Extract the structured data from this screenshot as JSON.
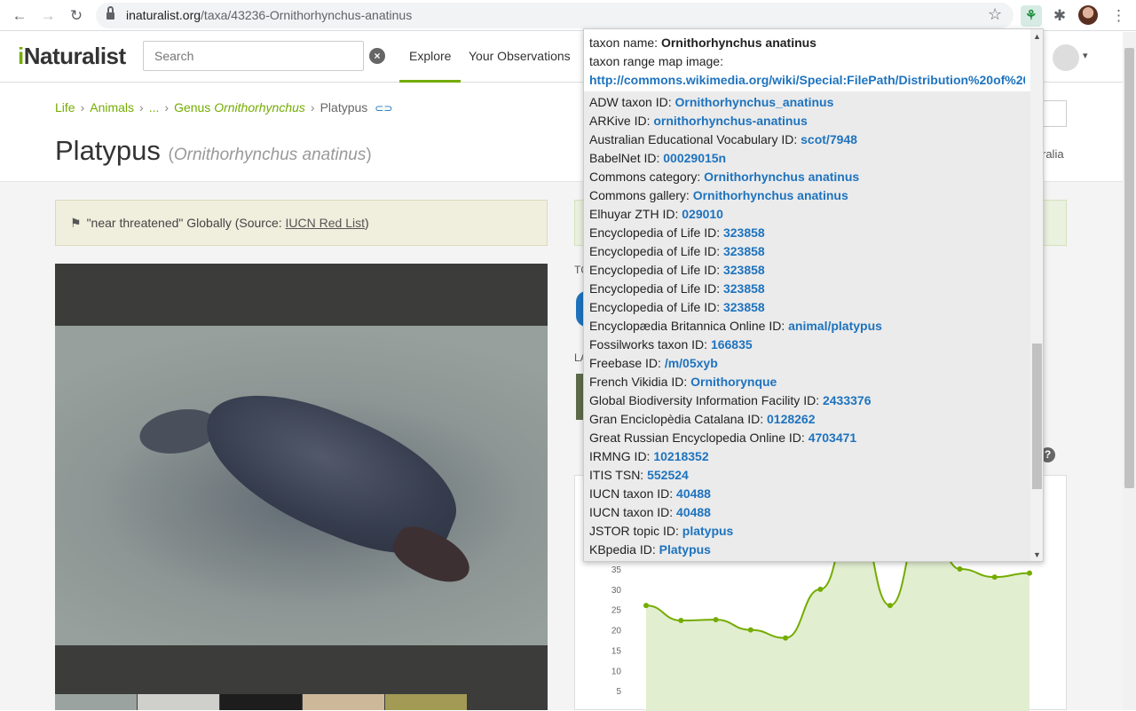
{
  "browser": {
    "url_domain": "inaturalist.org",
    "url_path": "/taxa/43236-Ornithorhynchus-anatinus"
  },
  "header": {
    "logo_i": "i",
    "logo_rest": "Naturalist",
    "search_placeholder": "Search",
    "nav": [
      "Explore",
      "Your Observations"
    ]
  },
  "breadcrumb": {
    "life": "Life",
    "animals": "Animals",
    "ellipsis": "...",
    "genus_prefix": "Genus ",
    "genus_name": "Ornithorhynchus",
    "current": "Platypus"
  },
  "taxon": {
    "common_name": "Platypus",
    "scientific_name": "Ornithorhynchus anatinus",
    "right_text": "ralia"
  },
  "status": {
    "status_text": "\"near threatened\" Globally (Source: ",
    "source_link": "IUCN Red List",
    "close_paren": ")"
  },
  "right_column": {
    "label_top": "TC",
    "label_mid": "LA"
  },
  "popup": {
    "taxon_name_label": "taxon name:",
    "taxon_name_value": "Ornithorhynchus anatinus",
    "range_map_label": "taxon range map image:",
    "range_map_url": "http://commons.wikimedia.org/wiki/Special:FilePath/Distribution%20of%20",
    "rows": [
      {
        "label": "ADW taxon ID:",
        "value": "Ornithorhynchus_anatinus"
      },
      {
        "label": "ARKive ID:",
        "value": "ornithorhynchus-anatinus"
      },
      {
        "label": "Australian Educational Vocabulary ID:",
        "value": "scot/7948"
      },
      {
        "label": "BabelNet ID:",
        "value": "00029015n"
      },
      {
        "label": "Commons category:",
        "value": "Ornithorhynchus anatinus"
      },
      {
        "label": "Commons gallery:",
        "value": "Ornithorhynchus anatinus"
      },
      {
        "label": "Elhuyar ZTH ID:",
        "value": "029010"
      },
      {
        "label": "Encyclopedia of Life ID:",
        "value": "323858"
      },
      {
        "label": "Encyclopedia of Life ID:",
        "value": "323858"
      },
      {
        "label": "Encyclopedia of Life ID:",
        "value": "323858"
      },
      {
        "label": "Encyclopedia of Life ID:",
        "value": "323858"
      },
      {
        "label": "Encyclopedia of Life ID:",
        "value": "323858"
      },
      {
        "label": "Encyclopædia Britannica Online ID:",
        "value": "animal/platypus"
      },
      {
        "label": "Fossilworks taxon ID:",
        "value": "166835"
      },
      {
        "label": "Freebase ID:",
        "value": "/m/05xyb"
      },
      {
        "label": "French Vikidia ID:",
        "value": "Ornithorynque"
      },
      {
        "label": "Global Biodiversity Information Facility ID:",
        "value": "2433376"
      },
      {
        "label": "Gran Enciclopèdia Catalana ID:",
        "value": "0128262"
      },
      {
        "label": "Great Russian Encyclopedia Online ID:",
        "value": "4703471"
      },
      {
        "label": "IRMNG ID:",
        "value": "10218352"
      },
      {
        "label": "ITIS TSN:",
        "value": "552524"
      },
      {
        "label": "IUCN taxon ID:",
        "value": "40488"
      },
      {
        "label": "IUCN taxon ID:",
        "value": "40488"
      },
      {
        "label": "JSTOR topic ID:",
        "value": "platypus"
      },
      {
        "label": "KBpedia ID:",
        "value": "Platypus"
      }
    ]
  },
  "chart_data": {
    "type": "area",
    "y_ticks": [
      "35",
      "30",
      "25",
      "20",
      "15",
      "10",
      "5"
    ],
    "ylim": [
      0,
      50
    ],
    "series": [
      {
        "values": [
          26,
          22.3,
          22.5,
          20,
          18,
          30,
          50,
          26,
          50,
          35,
          33,
          34
        ]
      }
    ],
    "colors": {
      "line": "#74ac00",
      "fill": "#e2eed0"
    }
  }
}
